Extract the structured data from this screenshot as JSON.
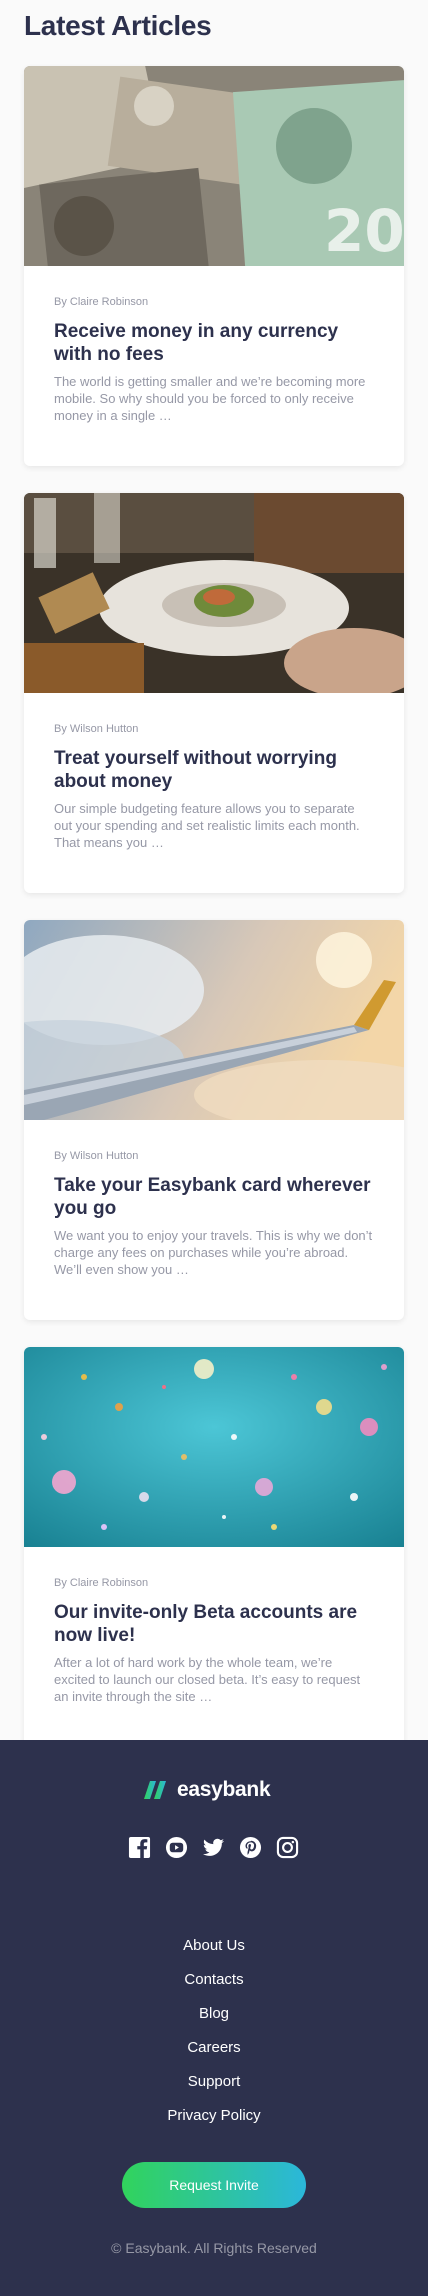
{
  "page": {
    "heading": "Latest Articles"
  },
  "articles": [
    {
      "image": "currency-banknotes-photo",
      "author": "By Claire Robinson",
      "title": "Receive money in any currency with no fees",
      "excerpt": "The world is getting smaller and we’re becoming more mobile. So why should you be forced to only receive money in a single …"
    },
    {
      "image": "restaurant-plate-photo",
      "author": "By Wilson Hutton",
      "title": "Treat yourself without worrying about money",
      "excerpt": "Our simple budgeting feature allows you to separate out your spending and set realistic limits each month. That means you …"
    },
    {
      "image": "airplane-wing-photo",
      "author": "By Wilson Hutton",
      "title": "Take your Easybank card wherever you go",
      "excerpt": "We want you to enjoy your travels. This is why we don’t charge any fees on purchases while you’re abroad. We’ll even show you …"
    },
    {
      "image": "confetti-photo",
      "author": "By Claire Robinson",
      "title": "Our invite-only Beta accounts are now live!",
      "excerpt": "After a lot of hard work by the whole team, we’re excited to launch our closed beta. It’s easy to request an invite through the site …"
    }
  ],
  "footer": {
    "brand": "easybank",
    "social_icons": [
      "facebook-icon",
      "youtube-icon",
      "twitter-icon",
      "pinterest-icon",
      "instagram-icon"
    ],
    "links": [
      "About Us",
      "Contacts",
      "Blog",
      "Careers",
      "Support",
      "Privacy Policy"
    ],
    "cta_label": "Request Invite",
    "copyright": "© Easybank. All Rights Reserved"
  },
  "colors": {
    "dark_blue": "#2d314d",
    "lime_green": "#31d35c",
    "bright_cyan": "#2bb7da",
    "grayish_blue": "#9698a6",
    "background": "#fafafa"
  }
}
